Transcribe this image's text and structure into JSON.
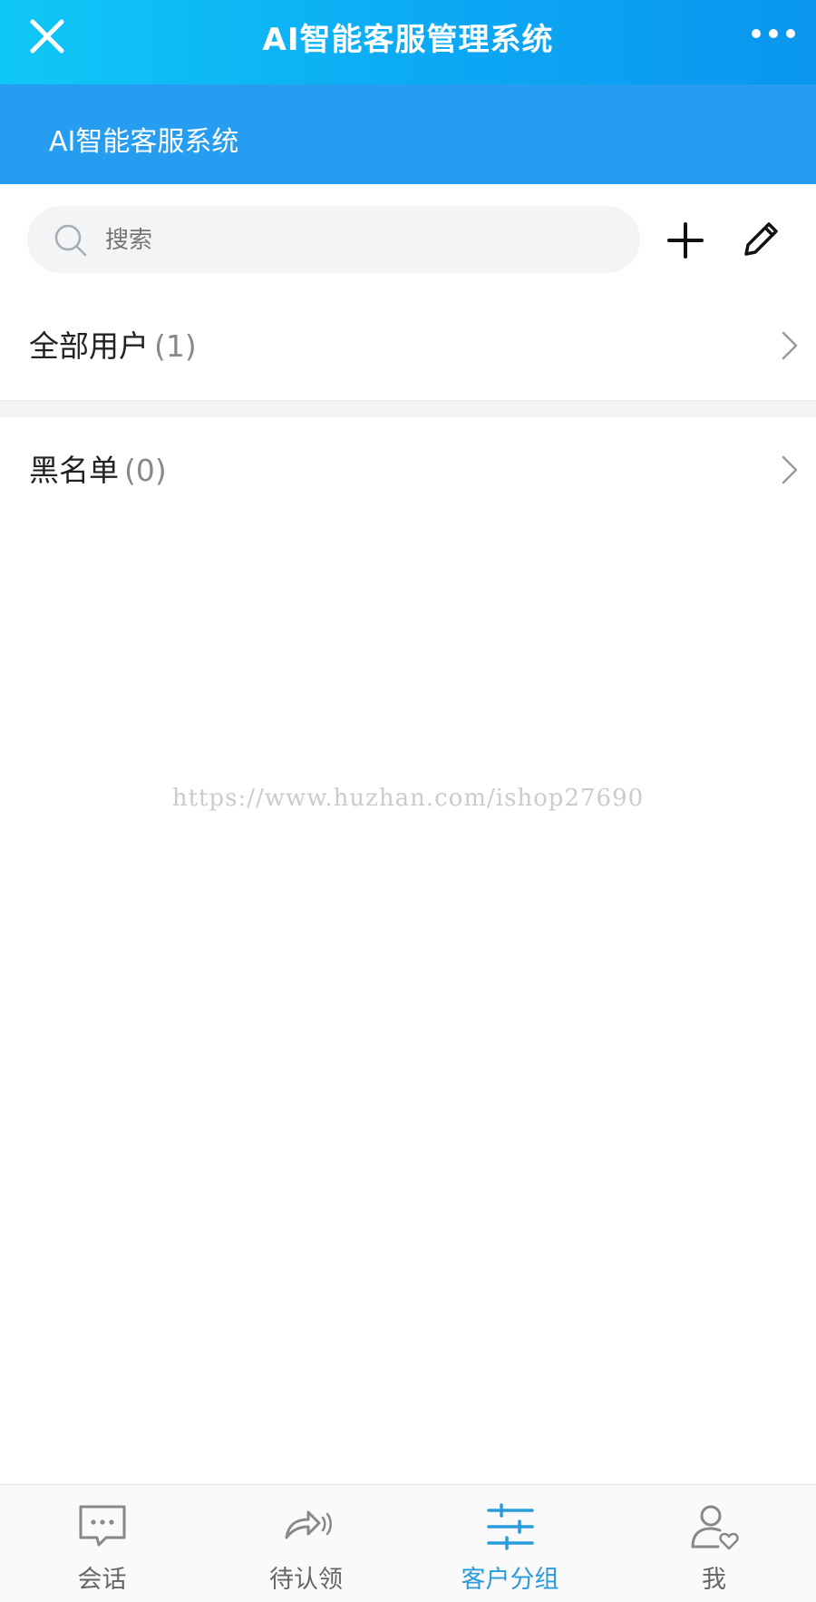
{
  "app": {
    "title": "AI智能客服管理系统",
    "subtitle": "AI智能客服系统"
  },
  "icons": {
    "close": "close-icon",
    "more": "more-dots-icon",
    "search": "search-icon",
    "add": "plus-icon",
    "edit": "pencil-icon",
    "chevron": "chevron-right-icon"
  },
  "search": {
    "placeholder": "搜索",
    "value": ""
  },
  "groups": [
    {
      "label": "全部用户",
      "count": "(1)"
    },
    {
      "label": "黑名单",
      "count": "(0)"
    }
  ],
  "watermark": "https://www.huzhan.com/ishop27690",
  "tabs": [
    {
      "label": "会话",
      "icon": "chat-bubble-icon",
      "active": false
    },
    {
      "label": "待认领",
      "icon": "forward-sound-icon",
      "active": false
    },
    {
      "label": "客户分组",
      "icon": "sliders-icon",
      "active": true
    },
    {
      "label": "我",
      "icon": "user-heart-icon",
      "active": false
    }
  ],
  "colors": {
    "topbar_start": "#0fc8f6",
    "topbar_end": "#0a96ee",
    "subheader": "#279df2",
    "accent": "#2a9bdb",
    "search_bg": "#f2f4f6"
  }
}
